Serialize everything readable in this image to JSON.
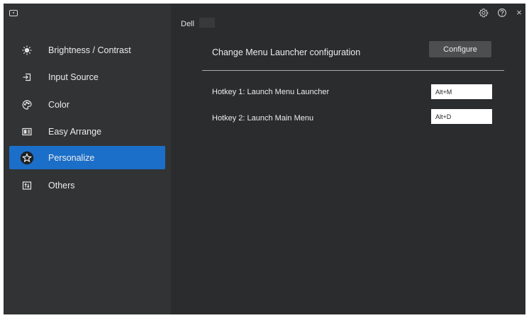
{
  "sidebar": {
    "items": [
      {
        "label": "Brightness / Contrast",
        "icon": "brightness-icon"
      },
      {
        "label": "Input Source",
        "icon": "input-source-icon"
      },
      {
        "label": "Color",
        "icon": "color-palette-icon"
      },
      {
        "label": "Easy Arrange",
        "icon": "easy-arrange-icon"
      },
      {
        "label": "Personalize",
        "icon": "star-icon",
        "active": true
      },
      {
        "label": "Others",
        "icon": "others-icon"
      }
    ]
  },
  "header": {
    "title": "Dell",
    "icons": [
      "settings-icon",
      "help-icon",
      "close-icon"
    ],
    "close_glyph": "×"
  },
  "main": {
    "config_label": "Change Menu Launcher configuration",
    "config_button": "Configure",
    "hotkeys": [
      {
        "label": "Hotkey 1: Launch Menu Launcher",
        "value": "Alt+M"
      },
      {
        "label": "Hotkey 2: Launch Main Menu",
        "value": "Alt+D"
      }
    ]
  },
  "colors": {
    "sidebar_bg": "#323335",
    "main_bg": "#2b2c2e",
    "active_accent": "#1b6fc8",
    "button_bg": "#4d4e50"
  }
}
